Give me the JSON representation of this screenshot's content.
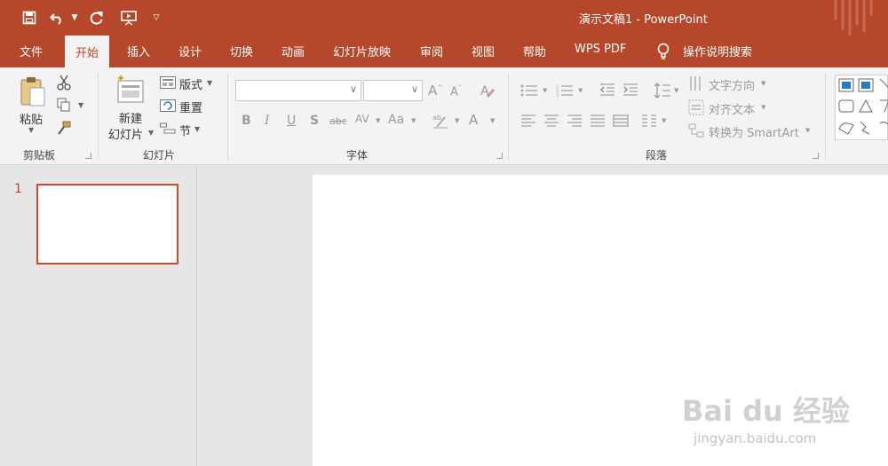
{
  "window": {
    "title": "演示文稿1  -  PowerPoint"
  },
  "quick_access": {
    "save_icon": "save-icon",
    "undo_icon": "undo-icon",
    "redo_icon": "repeat-icon",
    "present_icon": "start-from-beginning-icon",
    "customize_icon": "customize-dropdown-icon"
  },
  "tabs": [
    "文件",
    "开始",
    "插入",
    "设计",
    "切换",
    "动画",
    "幻灯片放映",
    "审阅",
    "视图",
    "帮助",
    "WPS PDF"
  ],
  "active_tab": "开始",
  "tell_me": {
    "label": "操作说明搜索"
  },
  "clipboard": {
    "paste": "粘贴",
    "group_label": "剪贴板"
  },
  "slides": {
    "new_slide_line1": "新建",
    "new_slide_line2": "幻灯片",
    "layout": "版式",
    "reset": "重置",
    "section": "节",
    "group_label": "幻灯片"
  },
  "font": {
    "name_value": "",
    "size_value": "",
    "aa": "Aa",
    "group_label": "字体"
  },
  "paragraph": {
    "text_direction": "文字方向",
    "align_text": "对齐文本",
    "convert_smartart": "转换为 SmartArt",
    "group_label": "段落"
  },
  "slide_panel": {
    "items": [
      {
        "number": "1"
      }
    ]
  },
  "watermark": {
    "logo": "Bai du 经验",
    "url": "jingyan.baidu.com"
  },
  "colors": {
    "accent": "#b7472a",
    "selection": "#d24726",
    "ribbon": "#f3f3f3",
    "workspace": "#e6e6e6"
  }
}
